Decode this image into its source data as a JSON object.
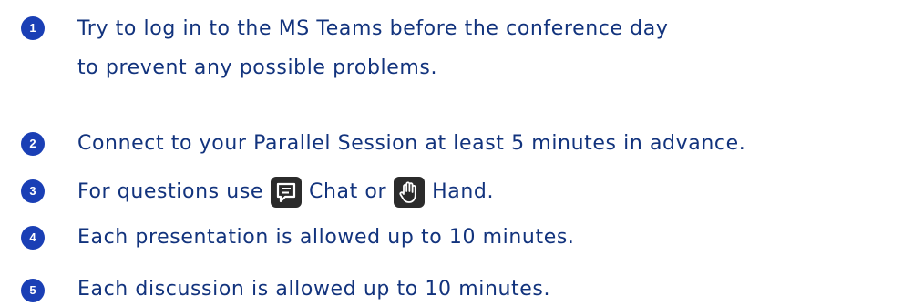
{
  "colors": {
    "accent": "#1a3fb5",
    "text": "#12337d",
    "icon_tile": "#2b2b2b"
  },
  "items": [
    {
      "number": "1",
      "lines": [
        "Try to log in to the MS Teams before the conference day",
        "to prevent any possible problems."
      ]
    },
    {
      "number": "2",
      "lines": [
        "Connect to your Parallel Session at least 5 minutes in advance."
      ]
    },
    {
      "number": "3",
      "prefix": "For questions use",
      "chat_label": "Chat or",
      "hand_label": "Hand.",
      "chat_icon": "chat-icon",
      "hand_icon": "raise-hand-icon"
    },
    {
      "number": "4",
      "lines": [
        "Each presentation is allowed up to 10 minutes."
      ]
    },
    {
      "number": "5",
      "lines": [
        "Each discussion is allowed up to 10 minutes."
      ]
    }
  ]
}
